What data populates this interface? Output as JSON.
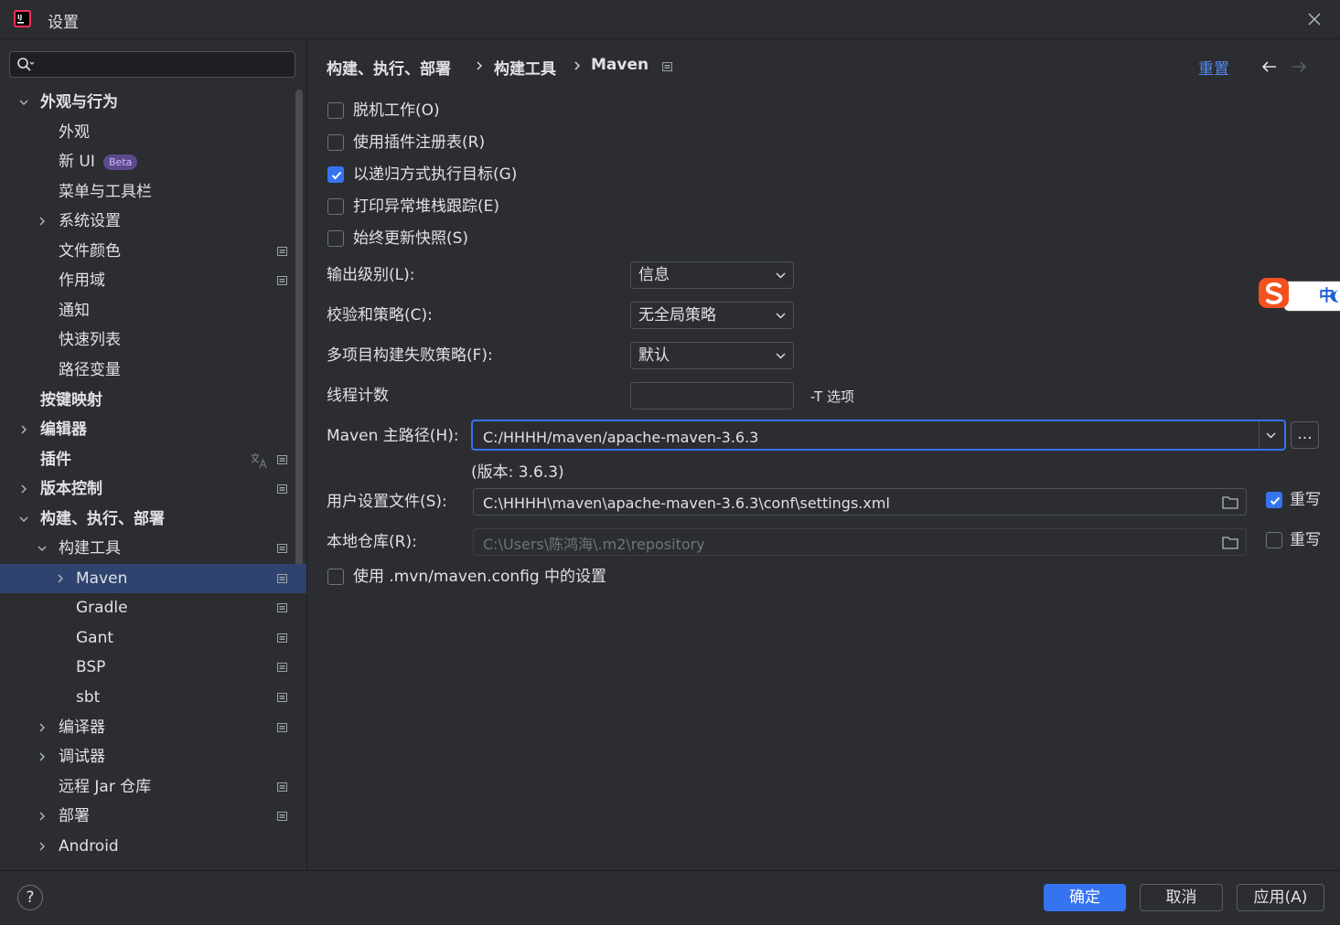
{
  "window": {
    "title": "设置"
  },
  "search": {
    "placeholder": "",
    "value": ""
  },
  "tree": [
    {
      "label": "外观与行为",
      "expanded": true,
      "level": 0
    },
    {
      "label": "外观",
      "level": 1
    },
    {
      "label": "新 UI",
      "badge": "Beta",
      "level": 1
    },
    {
      "label": "菜单与工具栏",
      "level": 1
    },
    {
      "label": "系统设置",
      "collapsed": true,
      "level": 1
    },
    {
      "label": "文件颜色",
      "level": 1,
      "project_icon": true
    },
    {
      "label": "作用域",
      "level": 1,
      "project_icon": true
    },
    {
      "label": "通知",
      "level": 1
    },
    {
      "label": "快速列表",
      "level": 1
    },
    {
      "label": "路径变量",
      "level": 1
    },
    {
      "label": "按键映射",
      "level": 0
    },
    {
      "label": "编辑器",
      "collapsed": true,
      "level": 0
    },
    {
      "label": "插件",
      "level": 0,
      "project_icon": true,
      "translate_icon": true
    },
    {
      "label": "版本控制",
      "collapsed": true,
      "level": 0,
      "project_icon": true
    },
    {
      "label": "构建、执行、部署",
      "expanded": true,
      "level": 0
    },
    {
      "label": "构建工具",
      "expanded": true,
      "level": 1,
      "project_icon": true
    },
    {
      "label": "Maven",
      "collapsed": true,
      "level": 2,
      "project_icon": true,
      "selected": true
    },
    {
      "label": "Gradle",
      "level": 2,
      "project_icon": true
    },
    {
      "label": "Gant",
      "level": 2,
      "project_icon": true
    },
    {
      "label": "BSP",
      "level": 2,
      "project_icon": true
    },
    {
      "label": "sbt",
      "level": 2,
      "project_icon": true
    },
    {
      "label": "编译器",
      "collapsed": true,
      "level": 1,
      "project_icon": true
    },
    {
      "label": "调试器",
      "collapsed": true,
      "level": 1
    },
    {
      "label": "远程 Jar 仓库",
      "level": 1,
      "project_icon": true
    },
    {
      "label": "部署",
      "collapsed": true,
      "level": 1,
      "project_icon": true
    },
    {
      "label": "Android",
      "collapsed": true,
      "level": 1
    }
  ],
  "breadcrumb": [
    "构建、执行、部署",
    "构建工具",
    "Maven"
  ],
  "header": {
    "reset": "重置"
  },
  "checkboxes": [
    {
      "label": "脱机工作(O)",
      "checked": false
    },
    {
      "label": "使用插件注册表(R)",
      "checked": false
    },
    {
      "label": "以递归方式执行目标(G)",
      "checked": true
    },
    {
      "label": "打印异常堆栈跟踪(E)",
      "checked": false
    },
    {
      "label": "始终更新快照(S)",
      "checked": false
    }
  ],
  "form": {
    "output_level": {
      "label": "输出级别(L):",
      "value": "信息"
    },
    "checksum_policy": {
      "label": "校验和策略(C):",
      "value": "无全局策略"
    },
    "multiproject_fail": {
      "label": "多项目构建失败策略(F):",
      "value": "默认"
    },
    "thread_count": {
      "label": "线程计数",
      "value": "",
      "hint": "-T 选项"
    },
    "maven_home": {
      "label": "Maven 主路径(H):",
      "value": "C:/HHHH/maven/apache-maven-3.6.3",
      "version": "(版本: 3.6.3)",
      "browse": "..."
    },
    "user_settings": {
      "label": "用户设置文件(S):",
      "value": "C:\\HHHH\\maven\\apache-maven-3.6.3\\conf\\settings.xml",
      "override_label": "重写",
      "override": true
    },
    "local_repo": {
      "label": "本地仓库(R):",
      "value": "C:\\Users\\陈鸿海\\.m2\\repository",
      "override_label": "重写",
      "override": false
    },
    "mvn_config": {
      "label": "使用 .mvn/maven.config 中的设置",
      "checked": false
    }
  },
  "ime": {
    "text": "中"
  },
  "footer": {
    "ok": "确定",
    "cancel": "取消",
    "apply": "应用(A)",
    "help": "?"
  },
  "colors": {
    "accent": "#3574f0",
    "link": "#548af7",
    "selection": "#2e436e",
    "background": "#2b2d30"
  }
}
